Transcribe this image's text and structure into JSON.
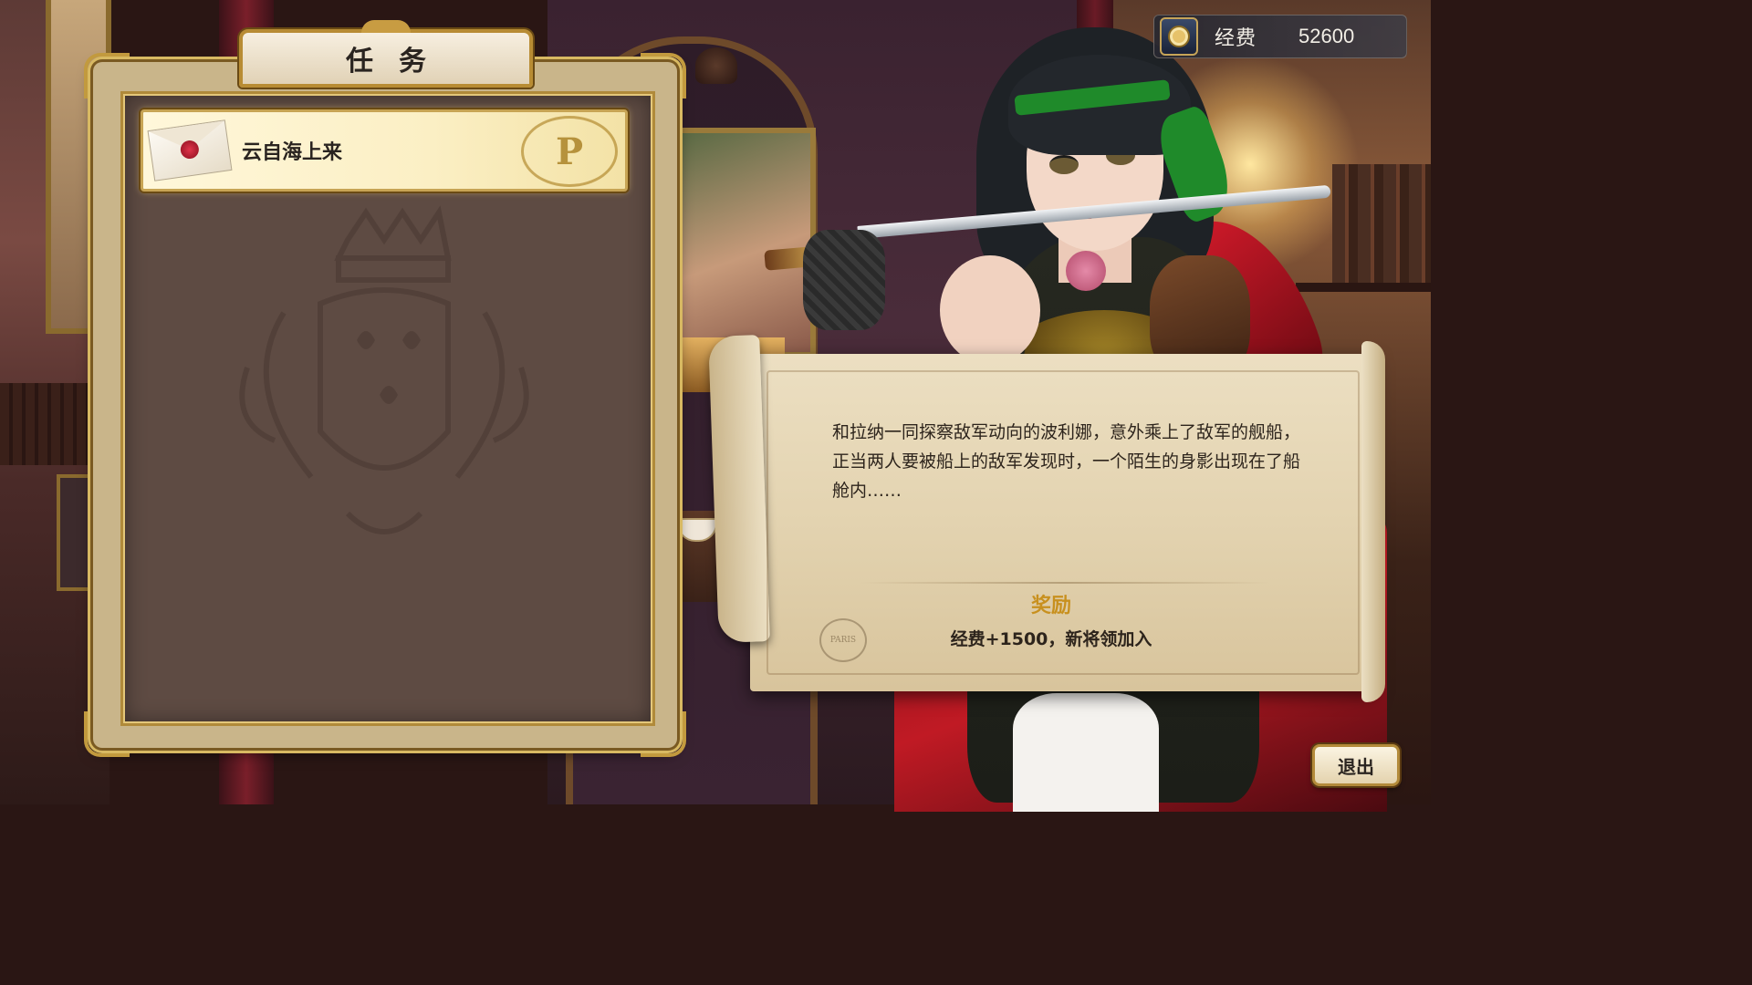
{
  "currency": {
    "label": "经费",
    "value": "52600",
    "icon": "coin-icon"
  },
  "quest_panel": {
    "title": "任务",
    "items": [
      {
        "name": "云自海上来",
        "icon": "sealed-envelope-icon",
        "selected": true,
        "stamp_icon": "p-crest-stamp-icon",
        "stamp_letter": "P"
      }
    ]
  },
  "quest_detail": {
    "description": "和拉纳一同探察敌军动向的波利娜，意外乘上了敌军的舰船，正当两人要被船上的敌军发现时，一个陌生的身影出现在了船舱内……",
    "reward_label": "奖励",
    "reward_text": "经费+1500，新将领加入",
    "seal_text": "PARIS"
  },
  "buttons": {
    "exit_label": "退出"
  },
  "colors": {
    "reward_accent": "#c8901e",
    "frame_gold": "#c29a3e",
    "panel_fill": "#5e4b43"
  }
}
